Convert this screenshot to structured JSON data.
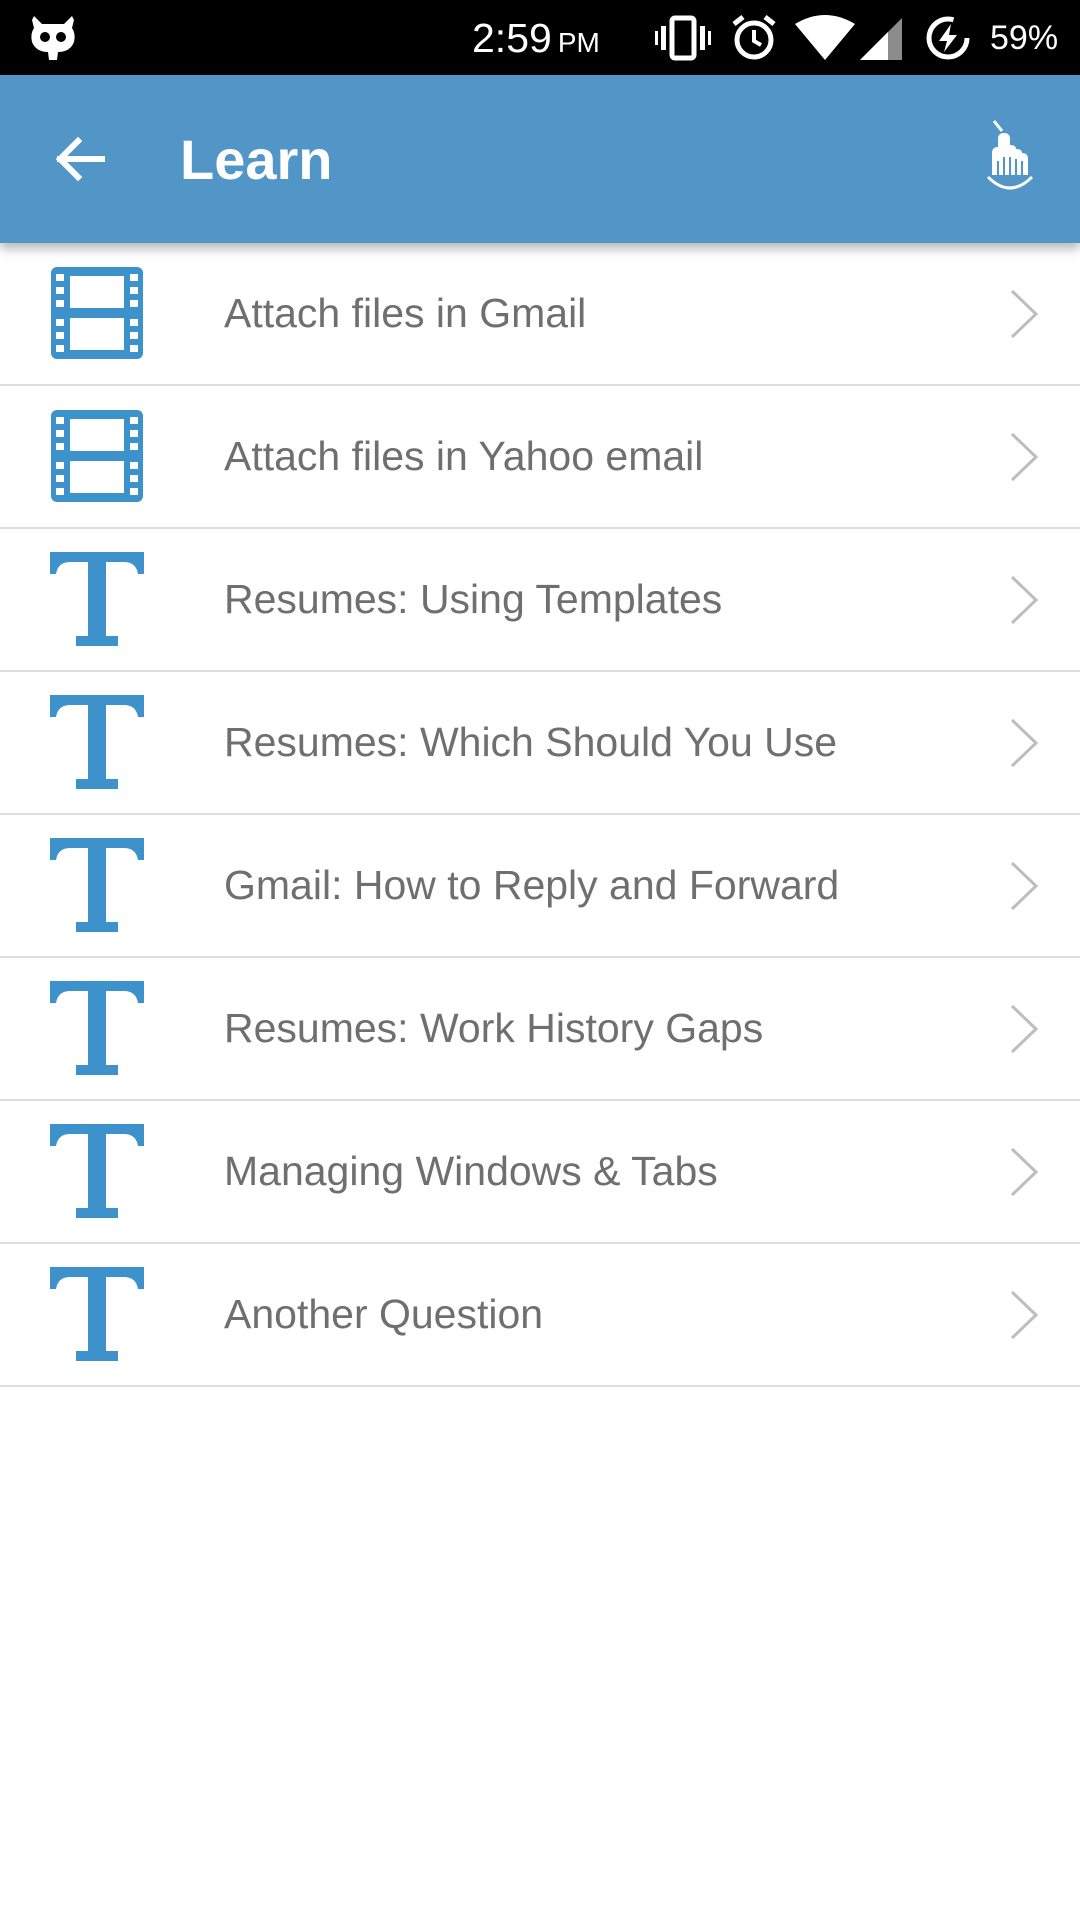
{
  "status_bar": {
    "time": "2:59",
    "ampm": "PM",
    "battery": "59%",
    "icons": [
      "cyanogen-mascot-icon",
      "vibrate-icon",
      "alarm-icon",
      "wifi-icon",
      "cell-signal-icon",
      "battery-charging-icon"
    ]
  },
  "app_bar": {
    "title": "Learn",
    "background": "#5296c8",
    "back_icon": "arrow-left-icon",
    "action_icon": "hand-pointer-icon"
  },
  "accent_icon_color": "#3e92cb",
  "lessons": [
    {
      "title": "Attach files in Gmail",
      "type": "video"
    },
    {
      "title": "Attach files in Yahoo email",
      "type": "video"
    },
    {
      "title": "Resumes: Using Templates",
      "type": "text"
    },
    {
      "title": "Resumes: Which Should You Use",
      "type": "text"
    },
    {
      "title": "Gmail: How to Reply and Forward",
      "type": "text"
    },
    {
      "title": "Resumes: Work History Gaps",
      "type": "text"
    },
    {
      "title": "Managing Windows & Tabs",
      "type": "text"
    },
    {
      "title": "Another Question",
      "type": "text"
    }
  ]
}
